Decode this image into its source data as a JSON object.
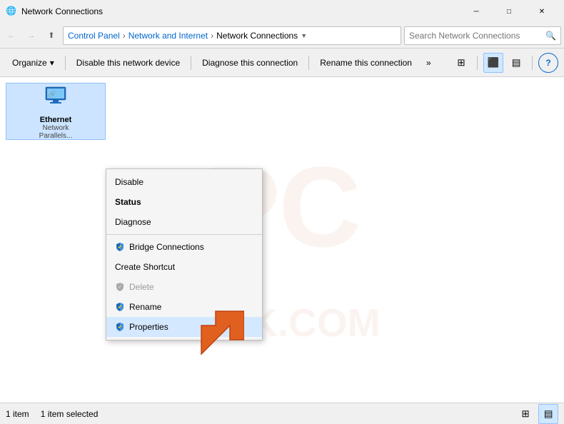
{
  "titlebar": {
    "title": "Network Connections",
    "icon": "🌐",
    "min_label": "─",
    "max_label": "□",
    "close_label": "✕"
  },
  "addressbar": {
    "back_label": "←",
    "forward_label": "→",
    "up_label": "↑",
    "breadcrumb": [
      {
        "label": "Control Panel",
        "sep": true
      },
      {
        "label": "Network and Internet",
        "sep": true
      },
      {
        "label": "Network Connections",
        "sep": false
      }
    ],
    "search_placeholder": "Search Network Connections",
    "search_icon": "🔍"
  },
  "toolbar": {
    "organize_label": "Organize",
    "organize_arrow": "▾",
    "disable_label": "Disable this network device",
    "diagnose_label": "Diagnose this connection",
    "rename_label": "Rename this connection",
    "more_label": "»",
    "help_label": "?"
  },
  "network_item": {
    "name": "Ethernet",
    "sub1": "Network",
    "sub2": "Parallels...",
    "icon": "🖥️"
  },
  "context_menu": {
    "items": [
      {
        "id": "disable",
        "label": "Disable",
        "icon": null,
        "bold": false,
        "disabled": false,
        "shield": false,
        "sep_after": false
      },
      {
        "id": "status",
        "label": "Status",
        "icon": null,
        "bold": true,
        "disabled": false,
        "shield": false,
        "sep_after": false
      },
      {
        "id": "diagnose",
        "label": "Diagnose",
        "icon": null,
        "bold": false,
        "disabled": false,
        "shield": false,
        "sep_after": true
      },
      {
        "id": "bridge",
        "label": "Bridge Connections",
        "icon": null,
        "bold": false,
        "disabled": false,
        "shield": true,
        "sep_after": false
      },
      {
        "id": "shortcut",
        "label": "Create Shortcut",
        "icon": null,
        "bold": false,
        "disabled": false,
        "shield": false,
        "sep_after": false
      },
      {
        "id": "delete",
        "label": "Delete",
        "icon": null,
        "bold": false,
        "disabled": true,
        "shield": true,
        "sep_after": false
      },
      {
        "id": "rename",
        "label": "Rename",
        "icon": null,
        "bold": false,
        "disabled": false,
        "shield": true,
        "sep_after": false
      },
      {
        "id": "properties",
        "label": "Properties",
        "icon": null,
        "bold": false,
        "disabled": false,
        "shield": true,
        "sep_after": false,
        "highlighted": true
      }
    ]
  },
  "statusbar": {
    "item_count": "1 item",
    "selected_count": "1 item selected"
  },
  "watermark": {
    "text1": "PC",
    "text2": "RISK.COM"
  }
}
